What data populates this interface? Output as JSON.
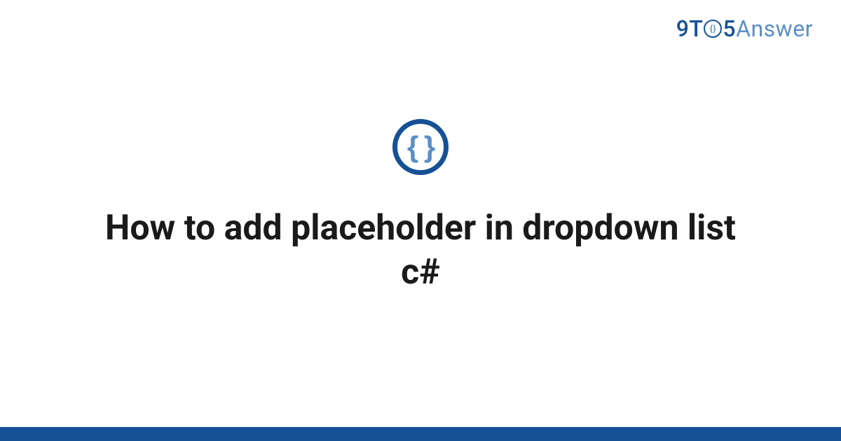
{
  "logo": {
    "part1": "9T",
    "part_o_inner": "{}",
    "part2": "5",
    "part3": "Answer"
  },
  "icon": {
    "braces": "{ }"
  },
  "title": "How to add placeholder in dropdown list c#",
  "colors": {
    "primary": "#165196",
    "secondary": "#5a8fc7",
    "text": "#1a1a1a"
  }
}
